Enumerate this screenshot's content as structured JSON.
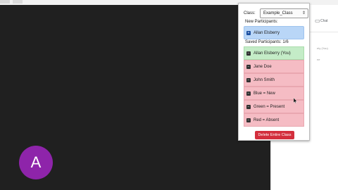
{
  "avatar": {
    "letter": "A",
    "color": "#8e24aa"
  },
  "side_panel": {
    "chat_label": "Chat",
    "chat_icon": "chat-bubble-icon",
    "faint_text_1": "ety (You)",
    "faint_text_2": "ne"
  },
  "popup": {
    "class_label": "Class:",
    "class_select_value": "Example_Class",
    "new_participants_label": "New Participants:",
    "new_participants": [
      {
        "name": "Allan Elsberry",
        "action_icon": "plus-icon"
      }
    ],
    "saved_participants_label": "Saved Participants: 1/6",
    "saved_participants": [
      {
        "name": "Allan Elsberry (You)",
        "status": "present",
        "action_icon": "minus-icon"
      },
      {
        "name": "Jane Doe",
        "status": "absent",
        "action_icon": "minus-icon"
      },
      {
        "name": "John Smith",
        "status": "absent",
        "action_icon": "minus-icon"
      },
      {
        "name": "Blue = New",
        "status": "absent",
        "action_icon": "minus-icon"
      },
      {
        "name": "Green = Present",
        "status": "absent",
        "action_icon": "minus-icon"
      },
      {
        "name": "Red = Absent",
        "status": "absent",
        "action_icon": "minus-icon"
      }
    ],
    "delete_button_label": "Delete Entire Class",
    "colors": {
      "new": "#b9d6f7",
      "present": "#c4ecc7",
      "absent": "#f5bcc4",
      "delete": "#d32f3d"
    }
  }
}
